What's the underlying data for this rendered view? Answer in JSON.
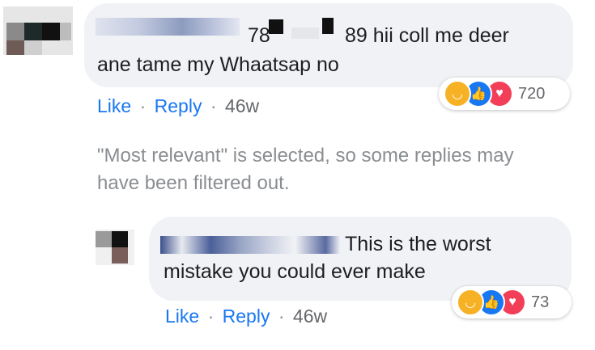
{
  "comment": {
    "text_line1_prefix": "78",
    "text_line1_suffix": "89 hii coll me deer",
    "text_line2": "ane tame my Whaatsap no",
    "reactions": {
      "icons": [
        "haha-emoji-icon",
        "like-emoji-icon",
        "love-emoji-icon"
      ],
      "count": "720"
    },
    "actions": {
      "like": "Like",
      "reply": "Reply",
      "age": "46w",
      "separator": "·"
    }
  },
  "filter_notice": {
    "line1": "\"Most relevant\" is selected, so some replies may",
    "line2": "have been filtered out."
  },
  "reply": {
    "text_line1": "This is the worst",
    "text_line2": "mistake you could ever make",
    "reactions": {
      "icons": [
        "haha-emoji-icon",
        "like-emoji-icon",
        "love-emoji-icon"
      ],
      "count": "73"
    },
    "actions": {
      "like": "Like",
      "reply": "Reply",
      "age": "46w",
      "separator": "·"
    }
  },
  "colors": {
    "bubble_bg": "#f0f2f5",
    "link": "#1877f2",
    "meta": "#65676b",
    "haha": "#f7b125",
    "like": "#1877f2",
    "love": "#f33e58"
  }
}
